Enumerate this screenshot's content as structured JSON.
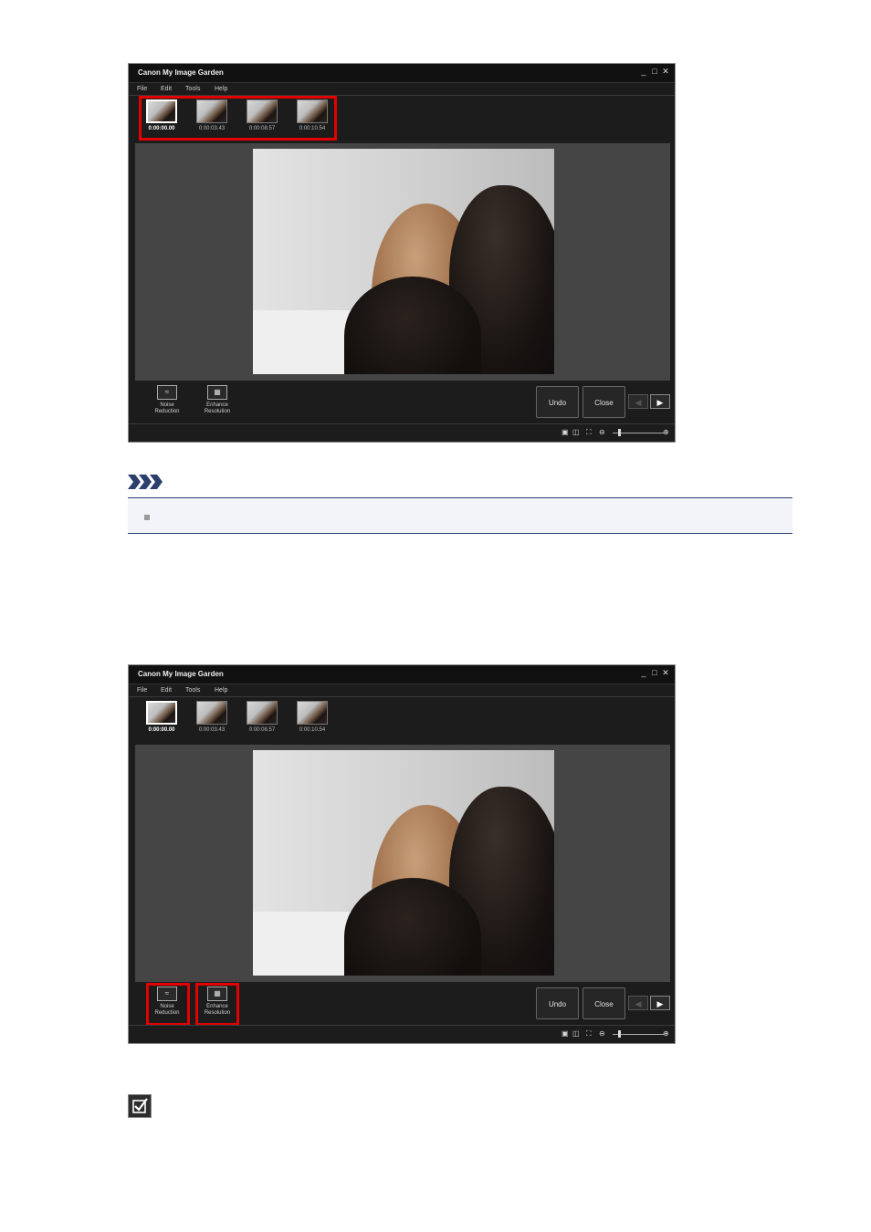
{
  "app": {
    "title": "Canon My Image Garden",
    "window_controls": [
      "_",
      "□",
      "✕"
    ]
  },
  "menu": [
    "File",
    "Edit",
    "Tools",
    "Help"
  ],
  "thumbnails": [
    {
      "timecode": "0:00:00.00",
      "selected": true
    },
    {
      "timecode": "0:00:03.43",
      "selected": false
    },
    {
      "timecode": "0:00:08.57",
      "selected": false
    },
    {
      "timecode": "0:00:10.54",
      "selected": false
    }
  ],
  "tools": {
    "noise_reduction": "Noise Reduction",
    "enhance_resolution": "Enhance Resolution"
  },
  "buttons": {
    "undo": "Undo",
    "close": "Close"
  },
  "icons": {
    "prev": "left-arrow-icon",
    "next": "right-arrow-icon",
    "zoom_out": "zoom-out-icon",
    "zoom_in": "zoom-in-icon",
    "note": "note-chevrons-icon",
    "checklist": "checklist-icon"
  },
  "colors": {
    "highlight": "#e20000",
    "window_bg": "#1c1c1c",
    "stage_bg": "#454545",
    "note_border": "#2c3e6b"
  }
}
